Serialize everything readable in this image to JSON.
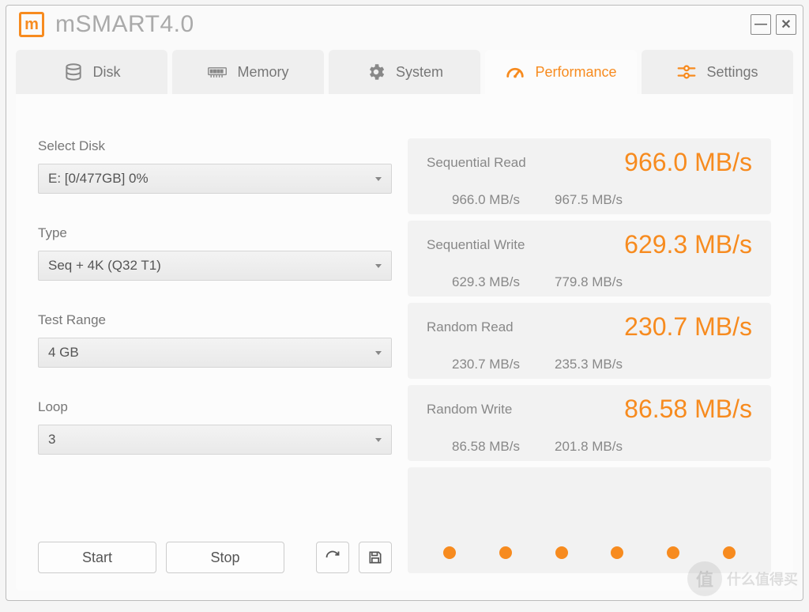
{
  "app": {
    "title": "mSMART4.0"
  },
  "window_controls": {
    "minimize": "—",
    "close": "✕"
  },
  "tabs": [
    {
      "id": "disk",
      "label": "Disk"
    },
    {
      "id": "memory",
      "label": "Memory"
    },
    {
      "id": "system",
      "label": "System"
    },
    {
      "id": "performance",
      "label": "Performance"
    },
    {
      "id": "settings",
      "label": "Settings"
    }
  ],
  "active_tab": "performance",
  "form": {
    "select_disk": {
      "label": "Select Disk",
      "value": "E: [0/477GB] 0%"
    },
    "type": {
      "label": "Type",
      "value": "Seq + 4K (Q32 T1)"
    },
    "test_range": {
      "label": "Test Range",
      "value": "4 GB"
    },
    "loop": {
      "label": "Loop",
      "value": "3"
    }
  },
  "buttons": {
    "start": "Start",
    "stop": "Stop"
  },
  "results": [
    {
      "label": "Sequential Read",
      "value": "966.0 MB/s",
      "sub1": "966.0 MB/s",
      "sub2": "967.5 MB/s"
    },
    {
      "label": "Sequential Write",
      "value": "629.3 MB/s",
      "sub1": "629.3 MB/s",
      "sub2": "779.8 MB/s"
    },
    {
      "label": "Random Read",
      "value": "230.7 MB/s",
      "sub1": "230.7 MB/s",
      "sub2": "235.3 MB/s"
    },
    {
      "label": "Random Write",
      "value": "86.58 MB/s",
      "sub1": "86.58 MB/s",
      "sub2": "201.8 MB/s"
    }
  ],
  "colors": {
    "accent": "#f78b1f"
  },
  "watermark": "什么值得买"
}
